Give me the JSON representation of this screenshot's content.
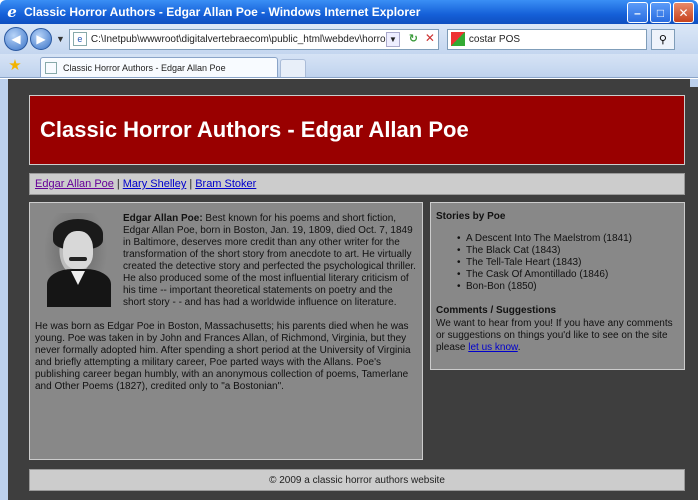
{
  "window": {
    "title": "Classic Horror Authors - Edgar Allan Poe - Windows Internet Explorer",
    "address": "C:\\Inetpub\\wwwroot\\digitalvertebraecom\\public_html\\webdev\\horror",
    "search": "costar POS",
    "tab_title": "Classic Horror Authors - Edgar Allan Poe"
  },
  "page": {
    "banner_title": "Classic Horror Authors - Edgar Allan Poe",
    "nav": [
      "Edgar Allan Poe",
      "Mary Shelley",
      "Bram Stoker"
    ],
    "nav_separator": "|",
    "bio": {
      "name": "Edgar Allan Poe:",
      "para1": " Best known for his poems and short fiction, Edgar Allan Poe, born in Boston, Jan. 19, 1809, died Oct. 7, 1849 in Baltimore, deserves more credit than any other writer for the transformation of the short story from anecdote to art. He virtually created the detective story and perfected the psychological thriller. He also produced some of the most influential literary criticism of his time -- important theoretical statements on poetry and the short story - - and has had a worldwide influence on literature.",
      "para2": "He was born as Edgar Poe in Boston, Massachusetts; his parents died when he was young. Poe was taken in by John and Frances Allan, of Richmond, Virginia, but they never formally adopted him. After spending a short period at the University of Virginia and briefly attempting a military career, Poe parted ways with the Allans. Poe's publishing career began humbly, with an anonymous collection of poems, Tamerlane and Other Poems (1827), credited only to \"a Bostonian\"."
    },
    "sidebar": {
      "stories_heading": "Stories by Poe",
      "stories": [
        "A Descent Into The Maelstrom (1841)",
        "The Black Cat (1843)",
        "The Tell-Tale Heart (1843)",
        "The Cask Of Amontillado (1846)",
        "Bon-Bon (1850)"
      ],
      "comments_heading": "Comments / Suggestions",
      "comments_text": "We want to hear from you! If you have any comments or suggestions on things you'd like to see on the site please ",
      "comments_link": "let us know",
      "comments_end": "."
    },
    "footer": "© 2009 a classic horror authors website"
  }
}
